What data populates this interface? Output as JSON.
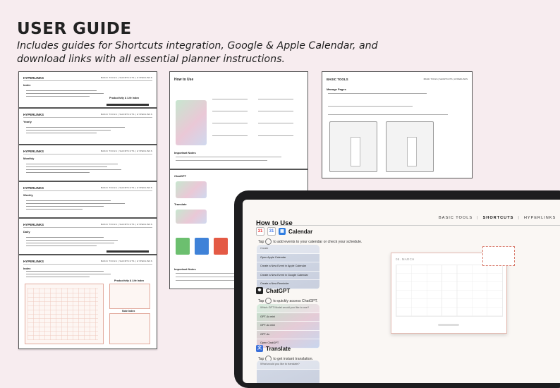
{
  "header": {
    "title": "USER GUIDE",
    "subtitle": "Includes guides for Shortcuts integration, Google & Apple Calendar, and download links with all essential planner instructions."
  },
  "left_stack": {
    "nav": "BASIC TOOLS  |  SHORTCUTS  |  HYPERLINKS",
    "pages": [
      {
        "heading": "HYPERLINKS",
        "section": "Index",
        "right_label": "Productivity & Life Index"
      },
      {
        "heading": "HYPERLINKS",
        "section": "Yearly"
      },
      {
        "heading": "HYPERLINKS",
        "section": "Monthly"
      },
      {
        "heading": "HYPERLINKS",
        "section": "Weekly"
      },
      {
        "heading": "HYPERLINKS",
        "section": "Daily"
      },
      {
        "heading": "HYPERLINKS",
        "section": "Index",
        "right_label": "Productivity & Life Index",
        "right_label_2": "Note Index"
      }
    ]
  },
  "middle_page": {
    "title": "How to Use",
    "important": "Important Notes",
    "chatgpt": "ChatGPT",
    "translate": "Translate",
    "important2": "Important Notes"
  },
  "right_page": {
    "heading": "BASIC TOOLS",
    "nav": "BASIC TOOLS  |  SHORTCUTS  |  HYPERLINKS",
    "subheading": "Manage Pages"
  },
  "tablet": {
    "title": "How to Use",
    "nav": {
      "basic": "BASIC TOOLS",
      "shortcuts": "SHORTCUTS",
      "hyperlinks": "HYPERLINKS",
      "sep": "|"
    },
    "calendar": {
      "label": "Calendar",
      "note_pre": "Tap",
      "note_post": "to add events to your calendar or check your schedule.",
      "menu": [
        "Create",
        "Open Apple Calendar",
        "Create a New Event in Apple Calendar",
        "Create a New Event in Google Calendar",
        "Create a New Reminder"
      ]
    },
    "chatgpt": {
      "label": "ChatGPT",
      "note_pre": "Tap",
      "note_post": "to quickly access ChatGPT.",
      "menu": [
        "Which GPT Model would you like to use?",
        "GPT-4o mini",
        "GPT-4o mini",
        "GPT-4o",
        "Open ChatGPT"
      ]
    },
    "translate": {
      "label": "Translate",
      "note_pre": "Tap",
      "note_post": "to get instant translation.",
      "menu": [
        "What would you like to translate?"
      ]
    },
    "month_label": "05. MARCH"
  }
}
